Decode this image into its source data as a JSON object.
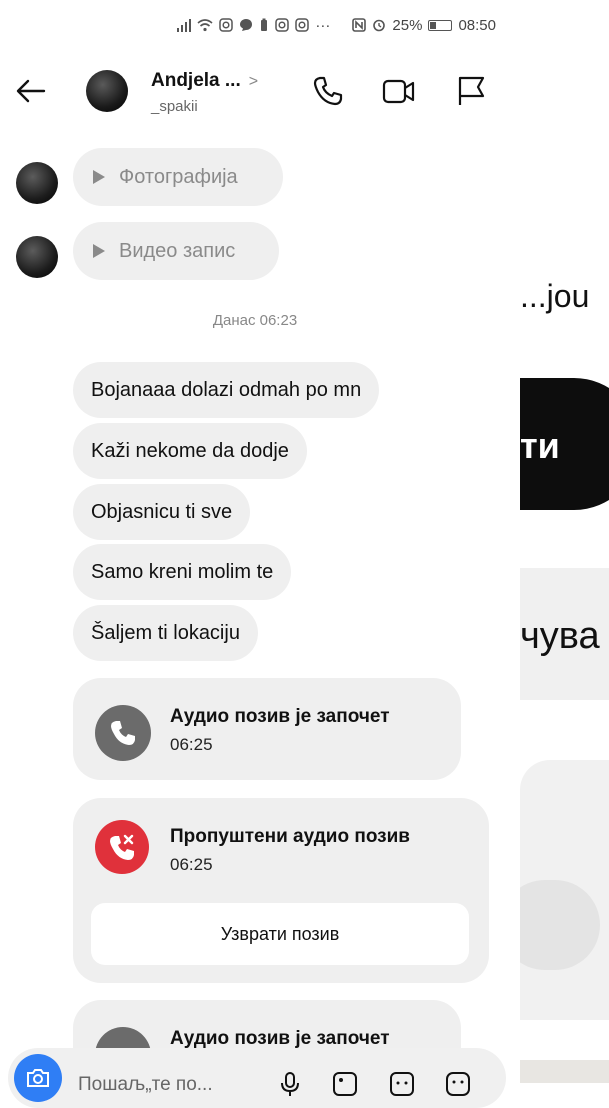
{
  "status_bar": {
    "battery": "25%",
    "time": "08:50"
  },
  "header": {
    "name": "Andjela ...",
    "chevron": ">",
    "username": "_spakii"
  },
  "attachments": [
    {
      "label": "Фотографија"
    },
    {
      "label": "Видео запис"
    }
  ],
  "date_separator": "Данас 06:23",
  "messages": [
    "Bojanaaa dolazi odmah po mn",
    "Kaži nekome da dodje",
    "Objasnicu ti sve",
    "Samo kreni molim te",
    "Šaljem ti lokaciju"
  ],
  "calls": [
    {
      "title": "Аудио позив је започет",
      "time": "06:25"
    },
    {
      "title": "Пропуштени аудио позив",
      "time": "06:25",
      "action": "Узврати позив"
    },
    {
      "title": "Аудио позив је започет"
    }
  ],
  "composer": {
    "placeholder": "Пошаљ„те по..."
  },
  "background_panel": {
    "text1": "...jou",
    "dark_button": "ти",
    "text2": "чува"
  },
  "colors": {
    "bubble": "#efefef",
    "missed_call": "#e0313b",
    "call_icon": "#6b6b6b",
    "camera": "#2f7ef5"
  }
}
